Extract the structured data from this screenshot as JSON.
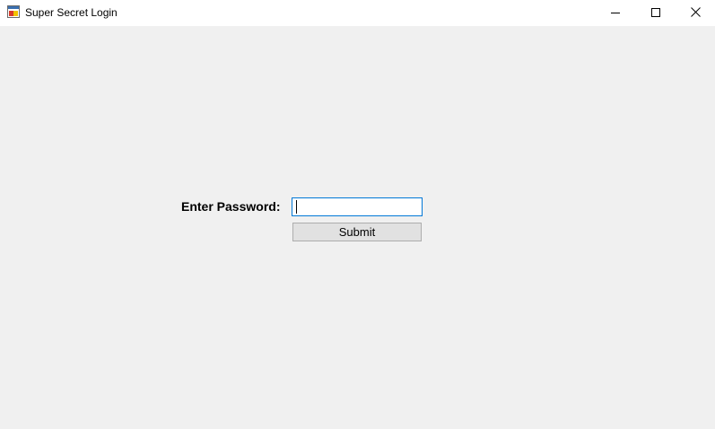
{
  "window": {
    "title": "Super Secret Login",
    "app_icon": "winforms-app-icon",
    "controls": {
      "minimize_icon": "minimize-icon",
      "maximize_icon": "maximize-icon",
      "close_icon": "close-icon"
    }
  },
  "form": {
    "password_label": "Enter Password:",
    "password_value": "",
    "password_placeholder": "",
    "submit_label": "Submit"
  },
  "colors": {
    "background": "#f0f0f0",
    "titlebar": "#ffffff",
    "input_focus_border": "#0078d7",
    "button_face": "#e1e1e1",
    "button_border": "#adadad"
  }
}
